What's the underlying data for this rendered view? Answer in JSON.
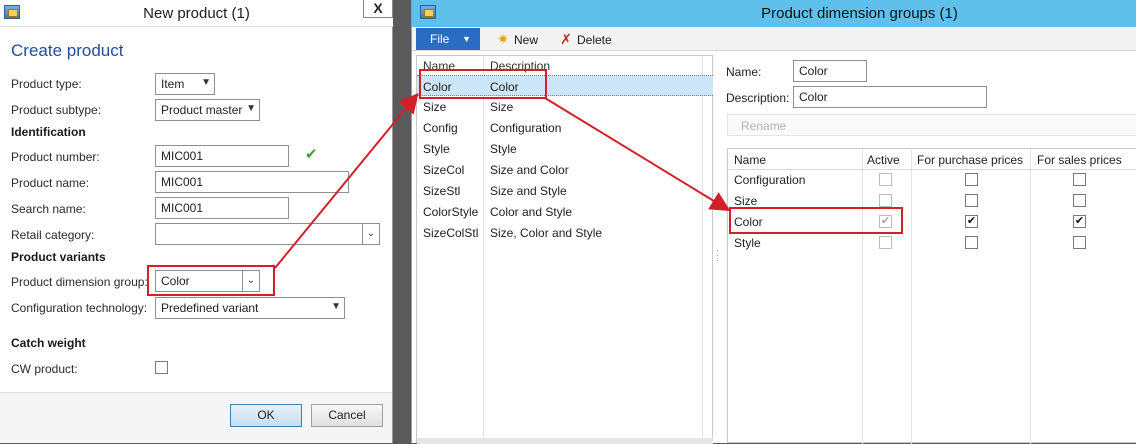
{
  "left_window": {
    "title": "New product (1)",
    "close_label": "X",
    "heading": "Create product",
    "product_type": {
      "label": "Product type:",
      "value": "Item"
    },
    "product_subtype": {
      "label": "Product subtype:",
      "value": "Product master"
    },
    "identification_heading": "Identification",
    "product_number": {
      "label": "Product number:",
      "value": "MIC001"
    },
    "product_name": {
      "label": "Product name:",
      "value": "MIC001"
    },
    "search_name": {
      "label": "Search name:",
      "value": "MIC001"
    },
    "retail_category": {
      "label": "Retail category:",
      "value": ""
    },
    "variants_heading": "Product variants",
    "dimension_group": {
      "label": "Product dimension group:",
      "value": "Color"
    },
    "configuration_technology": {
      "label": "Configuration technology:",
      "value": "Predefined variant"
    },
    "catch_weight_heading": "Catch weight",
    "cw_product": {
      "label": "CW product:",
      "checked": false
    },
    "ok_label": "OK",
    "cancel_label": "Cancel"
  },
  "right_window": {
    "title": "Product dimension groups (1)",
    "ribbon": {
      "file_label": "File",
      "new_label": "New",
      "delete_label": "Delete"
    },
    "list": {
      "headers": [
        "Name",
        "Description"
      ],
      "rows": [
        {
          "name": "Color",
          "description": "Color",
          "selected": true
        },
        {
          "name": "Size",
          "description": "Size"
        },
        {
          "name": "Config",
          "description": "Configuration"
        },
        {
          "name": "Style",
          "description": "Style"
        },
        {
          "name": "SizeCol",
          "description": "Size and Color"
        },
        {
          "name": "SizeStl",
          "description": "Size and Style"
        },
        {
          "name": "ColorStyle",
          "description": "Color and Style"
        },
        {
          "name": "SizeColStl",
          "description": "Size, Color and Style"
        }
      ]
    },
    "detail": {
      "name_label": "Name:",
      "name_value": "Color",
      "description_label": "Description:",
      "description_value": "Color",
      "rename_label": "Rename"
    },
    "grid": {
      "headers": [
        "Name",
        "Active",
        "For purchase prices",
        "For sales prices"
      ],
      "rows": [
        {
          "name": "Configuration",
          "active": false,
          "purchase": false,
          "sales": false
        },
        {
          "name": "Size",
          "active": false,
          "purchase": false,
          "sales": false
        },
        {
          "name": "Color",
          "active": true,
          "purchase": true,
          "sales": true
        },
        {
          "name": "Style",
          "active": false,
          "purchase": false,
          "sales": false
        }
      ]
    }
  },
  "colors": {
    "accent_blue": "#2a6cc4",
    "title_blue": "#5fc0ec",
    "annotation_red": "#d32027",
    "selection": "#cde6f7"
  },
  "icons": [
    "app-icon",
    "close-icon",
    "new-star-icon",
    "delete-x-icon",
    "checkmark-icon",
    "dropdown-arrow-icon"
  ]
}
